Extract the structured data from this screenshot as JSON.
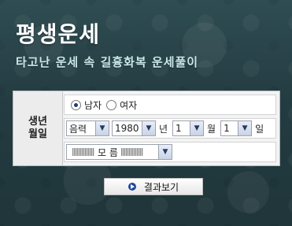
{
  "header": {
    "title": "평생운세",
    "subtitle": "타고난 운세 속  길흉화복 운세풀이"
  },
  "form": {
    "label_line1": "생년",
    "label_line2": "월일",
    "gender": {
      "male_label": "남자",
      "female_label": "여자",
      "selected": "남자"
    },
    "calendar_type": "음력",
    "year": "1980",
    "year_unit": "년",
    "month": "1",
    "month_unit": "월",
    "day": "1",
    "day_unit": "일",
    "birth_time": "모 름"
  },
  "submit": {
    "label": "결과보기"
  },
  "colors": {
    "background": "#2a464b",
    "accent": "#1f46a0"
  },
  "icons": {
    "dropdown": "chevron-down-icon",
    "submit": "play-icon"
  }
}
